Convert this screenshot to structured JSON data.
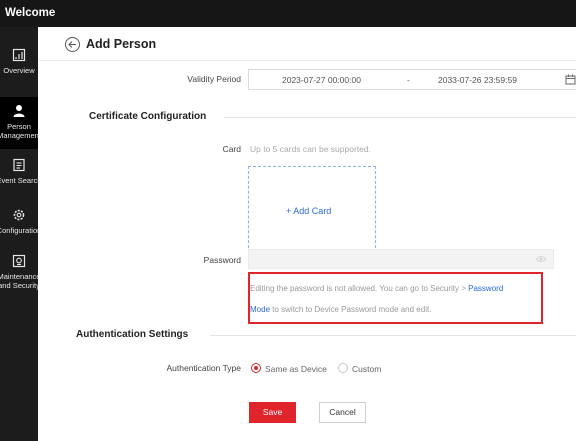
{
  "app": {
    "title": "Welcome"
  },
  "sidebar": {
    "items": [
      {
        "label": "Overview",
        "icon": "overview-icon",
        "active": false
      },
      {
        "label": "Person Management",
        "label_line1": "Person",
        "label_line2": "Management",
        "icon": "person-icon",
        "active": true
      },
      {
        "label": "Event Search",
        "icon": "event-search-icon",
        "active": false
      },
      {
        "label": "Configuration",
        "icon": "gear-icon",
        "active": false
      },
      {
        "label": "Maintenance and Security",
        "label_line1": "Maintenance",
        "label_line2": "and Security",
        "icon": "maintenance-icon",
        "active": false
      }
    ]
  },
  "header": {
    "title": "Add Person",
    "back_icon": "back-arrow-icon"
  },
  "validity": {
    "label": "Validity Period",
    "start": "2023-07-27 00:00:00",
    "separator": "-",
    "end": "2033-07-26 23:59:59",
    "icon": "calendar-icon"
  },
  "certificate": {
    "section_title": "Certificate Configuration",
    "card_label": "Card",
    "card_hint": "Up to 5 cards can be supported.",
    "add_card_label": "+ Add Card",
    "password_label": "Password",
    "password_value": "",
    "password_icon": "eye-icon",
    "warning_line1": "Editing the password is not allowed. You can go to Security > ",
    "warning_link_part1": "Password",
    "warning_link_part2": "Mode",
    "warning_line2": " to switch to Device Password mode and edit."
  },
  "authentication": {
    "section_title": "Authentication Settings",
    "type_label": "Authentication Type",
    "options": [
      {
        "label": "Same as Device",
        "checked": true
      },
      {
        "label": "Custom",
        "checked": false
      }
    ]
  },
  "actions": {
    "save_label": "Save",
    "cancel_label": "Cancel"
  },
  "colors": {
    "accent": "#e0242b",
    "link": "#2a6ad8",
    "sidebar_bg": "#1c1c1c",
    "topbar_bg": "#161616"
  }
}
